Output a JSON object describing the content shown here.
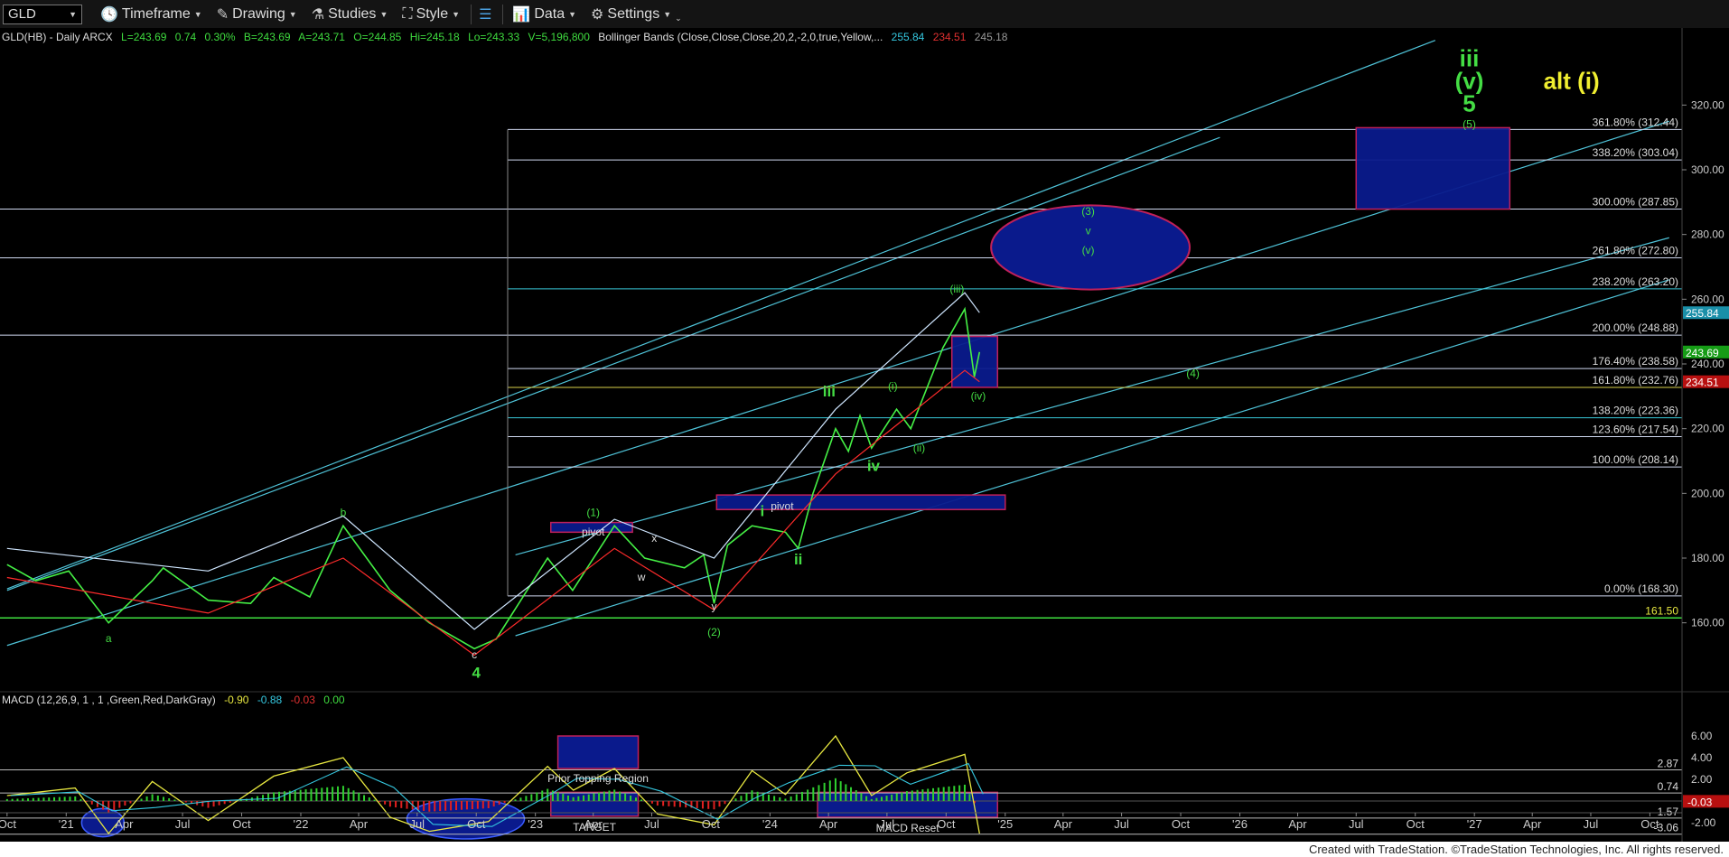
{
  "toolbar": {
    "symbol": "GLD",
    "timeframe": "Timeframe",
    "drawing": "Drawing",
    "studies": "Studies",
    "style": "Style",
    "data": "Data",
    "settings": "Settings"
  },
  "header": {
    "symbol_line": "GLD(HB) - Daily  ARCX",
    "last": "L=243.69",
    "chg": "0.74",
    "pct": "0.30%",
    "bid": "B=243.69",
    "ask": "A=243.71",
    "open": "O=244.85",
    "high": "Hi=245.18",
    "low": "Lo=243.33",
    "volume": "V=5,196,800",
    "study": "Bollinger Bands (Close,Close,Close,20,2,-2,0,true,Yellow,...",
    "bb_upper": "255.84",
    "bb_lower": "234.51",
    "bb_mid": "245.18"
  },
  "macd_header": {
    "label": "MACD (12,26,9, 1 , 1 ,Green,Red,DarkGray)",
    "v1": "-0.90",
    "v2": "-0.88",
    "v3": "-0.03",
    "v4": "0.00"
  },
  "footer": "Created with TradeStation. ©TradeStation Technologies, Inc. All rights reserved.",
  "colors": {
    "price_line": "#45f045",
    "upper_band": "#cfe6ff",
    "lower_band": "#ff2b2b",
    "channel": "#4fc3d8",
    "fib": "#cfd8f0",
    "box_fill": "#0a1a8c",
    "box_border": "#c0205a",
    "label_green": "#44dd44",
    "label_yellow": "#f0ee30"
  },
  "chart_data": {
    "type": "line",
    "title": "GLD(HB) - Daily",
    "ylim": [
      148,
      334
    ],
    "x_ticks": [
      "Oct",
      "'21",
      "Apr",
      "Jul",
      "Oct",
      "'22",
      "Apr",
      "Jul",
      "Oct",
      "'23",
      "Apr",
      "Jul",
      "Oct",
      "'24",
      "Apr",
      "Jul",
      "Oct",
      "'25",
      "Apr",
      "Jul",
      "Oct",
      "'26",
      "Apr",
      "Jul",
      "Oct",
      "'27",
      "Apr",
      "Jul",
      "Oct"
    ],
    "y_ticks": [
      160,
      180,
      200,
      220,
      240,
      260,
      280,
      300,
      320
    ],
    "series": [
      {
        "name": "Close",
        "x": [
          "2020-10-01",
          "2020-11-15",
          "2021-01-05",
          "2021-03-08",
          "2021-05-15",
          "2021-06-01",
          "2021-08-10",
          "2021-10-15",
          "2021-11-20",
          "2022-01-15",
          "2022-03-08",
          "2022-05-20",
          "2022-07-20",
          "2022-09-28",
          "2022-11-01",
          "2023-01-20",
          "2023-02-28",
          "2023-05-04",
          "2023-06-20",
          "2023-08-21",
          "2023-09-20",
          "2023-10-06",
          "2023-10-27",
          "2023-12-04",
          "2024-01-25",
          "2024-02-14",
          "2024-03-08",
          "2024-04-12",
          "2024-05-02",
          "2024-05-20",
          "2024-06-07",
          "2024-07-16",
          "2024-08-07",
          "2024-09-26",
          "2024-10-30",
          "2024-11-14",
          "2024-11-22"
        ],
        "values": [
          178,
          173,
          176,
          160,
          173,
          177,
          167,
          166,
          174,
          168,
          190,
          170,
          160,
          152,
          155,
          180,
          170,
          190,
          180,
          177,
          181,
          166,
          184,
          190,
          188,
          183,
          200,
          220,
          213,
          224,
          214,
          226,
          220,
          245,
          257,
          236,
          243.69
        ]
      },
      {
        "name": "Upper band",
        "x": [
          "2020-10-01",
          "2021-08-10",
          "2022-03-08",
          "2022-09-28",
          "2023-05-04",
          "2023-10-06",
          "2024-04-12",
          "2024-10-30",
          "2024-11-22"
        ],
        "values": [
          183,
          176,
          193,
          158,
          192,
          180,
          226,
          262,
          255.84
        ]
      },
      {
        "name": "Lower band",
        "x": [
          "2020-10-01",
          "2021-08-10",
          "2022-03-08",
          "2022-09-28",
          "2023-05-04",
          "2023-10-06",
          "2024-04-12",
          "2024-10-30",
          "2024-11-22"
        ],
        "values": [
          174,
          163,
          180,
          150,
          183,
          164,
          206,
          238,
          234.51
        ]
      }
    ],
    "price_flags": [
      {
        "value": 255.84,
        "label": "255.84",
        "color": "#1a8fa8"
      },
      {
        "value": 243.69,
        "label": "243.69",
        "color": "#169c16"
      },
      {
        "value": 234.51,
        "label": "234.51",
        "color": "#b81010"
      }
    ],
    "fib_levels": [
      {
        "pct": "361.80%",
        "value": 312.44,
        "label": "361.80% (312.44)"
      },
      {
        "pct": "338.20%",
        "value": 303.04,
        "label": "338.20% (303.04)"
      },
      {
        "pct": "300.00%",
        "value": 287.85,
        "label": "300.00% (287.85)"
      },
      {
        "pct": "261.80%",
        "value": 272.8,
        "label": "261.80% (272.80)"
      },
      {
        "pct": "238.20%",
        "value": 263.2,
        "label": "238.20% (263.20)"
      },
      {
        "pct": "200.00%",
        "value": 248.88,
        "label": "200.00% (248.88)"
      },
      {
        "pct": "176.40%",
        "value": 238.58,
        "label": "176.40% (238.58)"
      },
      {
        "pct": "161.80%",
        "value": 232.76,
        "label": "161.80% (232.76)"
      },
      {
        "pct": "138.20%",
        "value": 223.36,
        "label": "138.20% (223.36)"
      },
      {
        "pct": "123.60%",
        "value": 217.54,
        "label": "123.60% (217.54)"
      },
      {
        "pct": "100.00%",
        "value": 208.14,
        "label": "100.00% (208.14)"
      },
      {
        "pct": "0.00%",
        "value": 168.3,
        "label": "0.00% (168.30)"
      }
    ],
    "support_line": {
      "value": 161.5,
      "label": "161.50"
    },
    "wave_labels": [
      {
        "text": "iii",
        "x": "2026-12-24",
        "y": 332,
        "color": "green",
        "size": "big"
      },
      {
        "text": "(v)",
        "x": "2026-12-24",
        "y": 325,
        "color": "green",
        "size": "big"
      },
      {
        "text": "5",
        "x": "2026-12-24",
        "y": 318,
        "color": "green",
        "size": "big"
      },
      {
        "text": "(5)",
        "x": "2026-12-24",
        "y": 313,
        "color": "green",
        "size": "small"
      },
      {
        "text": "alt (i)",
        "x": "2027-06-01",
        "y": 325,
        "color": "yellow",
        "size": "big"
      },
      {
        "text": "(3)",
        "x": "2025-05-10",
        "y": 286,
        "color": "green",
        "size": "small"
      },
      {
        "text": "v",
        "x": "2025-05-10",
        "y": 280,
        "color": "green",
        "size": "small"
      },
      {
        "text": "(v)",
        "x": "2025-05-10",
        "y": 274,
        "color": "green",
        "size": "small"
      },
      {
        "text": "(iii)",
        "x": "2024-10-18",
        "y": 262,
        "color": "green",
        "size": "small"
      },
      {
        "text": "(iv)",
        "x": "2024-11-20",
        "y": 229,
        "color": "green",
        "size": "small"
      },
      {
        "text": "(4)",
        "x": "2025-10-20",
        "y": 236,
        "color": "green",
        "size": "small"
      },
      {
        "text": "iii",
        "x": "2024-04-02",
        "y": 230,
        "color": "green",
        "size": "mid"
      },
      {
        "text": "(i)",
        "x": "2024-07-10",
        "y": 232,
        "color": "green",
        "size": "small"
      },
      {
        "text": "(ii)",
        "x": "2024-08-20",
        "y": 213,
        "color": "green",
        "size": "small"
      },
      {
        "text": "iv",
        "x": "2024-06-10",
        "y": 207,
        "color": "green",
        "size": "mid"
      },
      {
        "text": "i",
        "x": "2023-12-20",
        "y": 193,
        "color": "green",
        "size": "mid"
      },
      {
        "text": "ii",
        "x": "2024-02-14",
        "y": 178,
        "color": "green",
        "size": "mid"
      },
      {
        "text": "pivot",
        "x": "2024-01-20",
        "y": 195,
        "color": "white",
        "size": "small"
      },
      {
        "text": "pivot",
        "x": "2023-04-01",
        "y": 187,
        "color": "white",
        "size": "small"
      },
      {
        "text": "(1)",
        "x": "2023-04-01",
        "y": 193,
        "color": "green",
        "size": "small"
      },
      {
        "text": "x",
        "x": "2023-07-05",
        "y": 185,
        "color": "white",
        "size": "small"
      },
      {
        "text": "w",
        "x": "2023-06-15",
        "y": 173,
        "color": "white",
        "size": "small"
      },
      {
        "text": "y",
        "x": "2023-10-06",
        "y": 164,
        "color": "white",
        "size": "small"
      },
      {
        "text": "(2)",
        "x": "2023-10-06",
        "y": 156,
        "color": "green",
        "size": "small"
      },
      {
        "text": "b",
        "x": "2022-03-08",
        "y": 193,
        "color": "green",
        "size": "small"
      },
      {
        "text": "a",
        "x": "2021-03-08",
        "y": 154,
        "color": "green",
        "size": "small"
      },
      {
        "text": "c",
        "x": "2022-09-28",
        "y": 149,
        "color": "white",
        "size": "small"
      },
      {
        "text": "4",
        "x": "2022-10-01",
        "y": 143,
        "color": "green",
        "size": "mid"
      }
    ],
    "target_zones": [
      {
        "shape": "rect",
        "x0": "2026-07-01",
        "x1": "2027-02-25",
        "y0": 287.85,
        "y1": 313
      },
      {
        "shape": "ellipse",
        "x0": "2024-12-10",
        "x1": "2025-10-15",
        "y0": 263,
        "y1": 289
      },
      {
        "shape": "rect",
        "x0": "2024-10-10",
        "x1": "2024-12-20",
        "y0": 232.76,
        "y1": 248.5
      },
      {
        "shape": "rect",
        "x0": "2023-10-10",
        "x1": "2025-01-01",
        "y0": 195,
        "y1": 199.5
      },
      {
        "shape": "rect",
        "x0": "2023-01-25",
        "x1": "2023-06-01",
        "y0": 188,
        "y1": 191
      }
    ],
    "channels": [
      {
        "x0": "2020-10-01",
        "y0": 170.5,
        "x1": "2026-11-01",
        "y1": 340
      },
      {
        "x0": "2020-10-01",
        "y0": 153,
        "x1": "2027-10-31",
        "y1": 315
      },
      {
        "x0": "2022-12-01",
        "y0": 181,
        "x1": "2027-10-31",
        "y1": 279
      },
      {
        "x0": "2022-12-01",
        "y0": 156,
        "x1": "2027-10-31",
        "y1": 266
      },
      {
        "x0": "2020-10-01",
        "y0": 170,
        "x1": "2025-12-01",
        "y1": 310
      }
    ],
    "macd": {
      "ylim": [
        -3.9,
        7.1
      ],
      "y_ticks": [
        6.0,
        4.0,
        2.0,
        -2.0
      ],
      "levels": [
        {
          "value": 2.87,
          "label": "2.87"
        },
        {
          "value": 0.74,
          "label": "0.74"
        },
        {
          "value": -1.57,
          "label": "-1.57"
        },
        {
          "value": -3.06,
          "label": "-3.06"
        }
      ],
      "current": "-0.03",
      "macd_x": [
        "2020-10-01",
        "2021-01-15",
        "2021-03-08",
        "2021-05-15",
        "2021-08-10",
        "2021-11-20",
        "2022-03-08",
        "2022-05-20",
        "2022-07-20",
        "2022-10-20",
        "2023-01-20",
        "2023-03-01",
        "2023-05-04",
        "2023-07-10",
        "2023-10-06",
        "2023-12-04",
        "2024-01-25",
        "2024-04-12",
        "2024-06-07",
        "2024-08-01",
        "2024-10-30",
        "2024-11-22"
      ],
      "macd_values": [
        0.5,
        1.2,
        -3.0,
        1.8,
        -1.8,
        2.3,
        4.0,
        -1.5,
        -2.8,
        -1.9,
        3.2,
        1.0,
        3.0,
        -1.2,
        -2.2,
        2.8,
        0.6,
        6.0,
        0.5,
        2.6,
        4.3,
        -3.0
      ],
      "zones": [
        {
          "label": "Prior Topping Region",
          "x0": "2023-02-05",
          "x1": "2023-06-10",
          "y0": 3.0,
          "y1": 6.0
        },
        {
          "label": "TARGET",
          "x0": "2023-01-25",
          "x1": "2023-06-10",
          "y0": -1.4,
          "y1": 0.8
        },
        {
          "label": "MACD Reset",
          "x0": "2024-03-15",
          "x1": "2024-12-20",
          "y0": -1.5,
          "y1": 0.8
        },
        {
          "label": "",
          "x0": "2022-06-15",
          "x1": "2022-12-15",
          "y0": -3.5,
          "y1": 0.2,
          "shape": "ellipse"
        },
        {
          "label": "",
          "x0": "2021-01-25",
          "x1": "2021-04-01",
          "y0": -3.3,
          "y1": -0.7,
          "shape": "ellipse"
        }
      ]
    }
  }
}
